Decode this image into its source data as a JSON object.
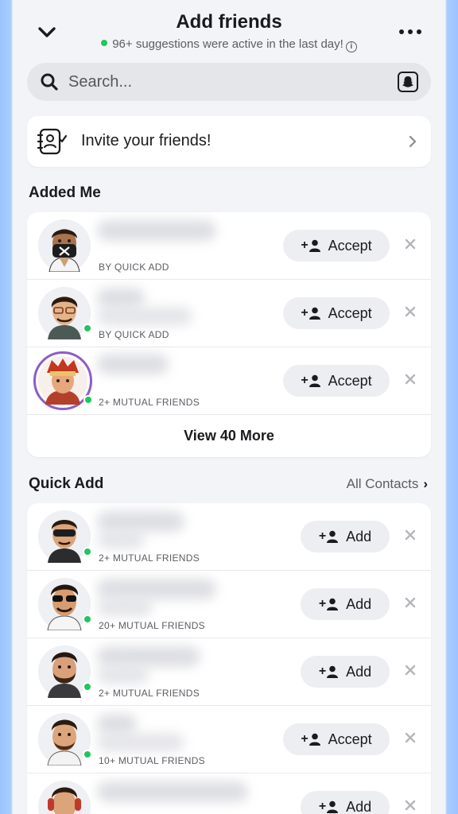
{
  "header": {
    "title": "Add friends",
    "subtitle": "96+ suggestions were active in the last day!",
    "back_icon": "chevron-down-icon",
    "more_icon": "more-dots-icon"
  },
  "search": {
    "placeholder": "Search...",
    "value": ""
  },
  "invite": {
    "label": "Invite your friends!"
  },
  "added_me": {
    "title": "Added Me",
    "rows": [
      {
        "subtitle": "BY QUICK ADD",
        "action": "Accept",
        "online": false
      },
      {
        "subtitle": "BY QUICK ADD",
        "action": "Accept",
        "online": true
      },
      {
        "subtitle": "2+ MUTUAL FRIENDS",
        "action": "Accept",
        "online": true
      }
    ],
    "view_more": "View 40 More"
  },
  "quick_add": {
    "title": "Quick Add",
    "link": "All Contacts",
    "rows": [
      {
        "subtitle": "2+ MUTUAL FRIENDS",
        "action": "Add",
        "online": true
      },
      {
        "subtitle": "20+ MUTUAL FRIENDS",
        "action": "Add",
        "online": true
      },
      {
        "subtitle": "2+ MUTUAL FRIENDS",
        "action": "Add",
        "online": true
      },
      {
        "subtitle": "10+ MUTUAL FRIENDS",
        "action": "Accept",
        "online": true
      },
      {
        "subtitle": "",
        "action": "Add",
        "online": false
      }
    ]
  },
  "colors": {
    "online": "#22c55e",
    "ring": "#8e5cc7",
    "button_bg": "#eceef1"
  }
}
